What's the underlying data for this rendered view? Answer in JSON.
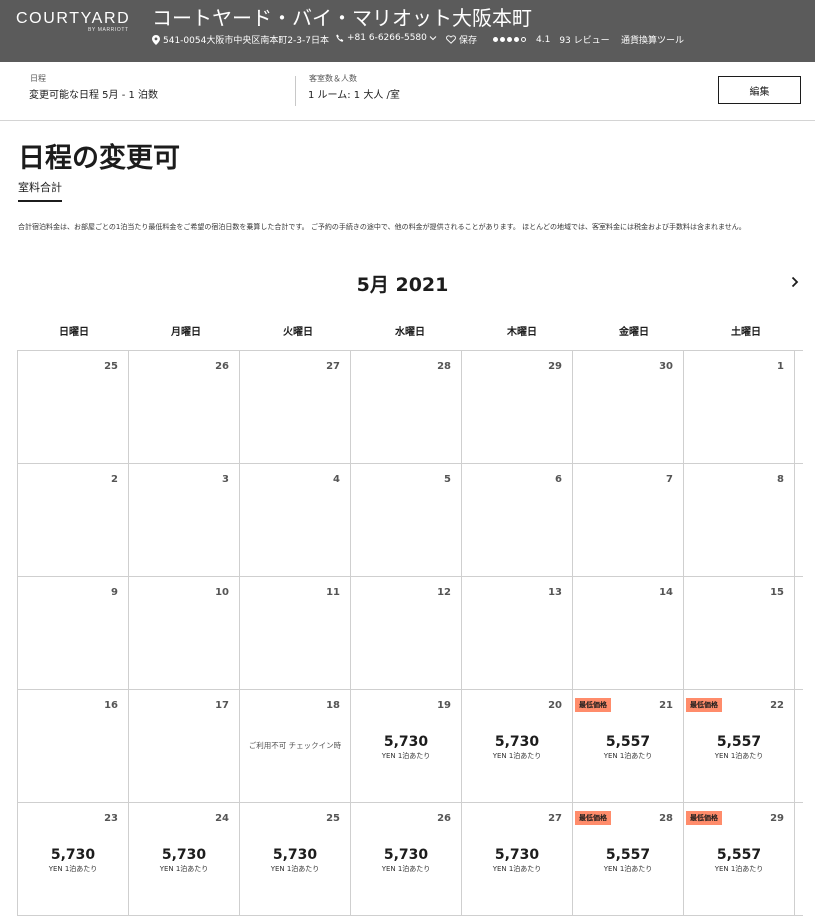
{
  "header": {
    "brand": "COURTYARD",
    "brand_sub": "BY MARRIOTT",
    "hotel_name": "コートヤード・バイ・マリオット大阪本町",
    "address": "541-0054大阪市中央区南本町2-3-7日本",
    "phone": "+81 6-6266-5580",
    "save": "保存",
    "rating": "4.1",
    "reviews": "93 レビュー",
    "currency_tool": "通貨換算ツール"
  },
  "search": {
    "dates_label": "日程",
    "dates_value": "変更可能な日程 5月 - 1 泊数",
    "guests_label": "客室数＆人数",
    "guests_value": "1 ルーム: 1 大人 /室",
    "edit": "編集"
  },
  "page": {
    "title": "日程の変更可",
    "tab": "室料合計",
    "disclaimer": "合計宿泊料金は、お部屋ごとの1泊当たり最低料金をご希望の宿泊日数を乗算した合計です。 ご予約の手続きの途中で、他の料金が提供されることがあります。 ほとんどの地域では、客室料金には税金および手数料は含まれません。"
  },
  "calendar": {
    "month": "5月 2021",
    "weekdays": [
      "日曜日",
      "月曜日",
      "火曜日",
      "水曜日",
      "木曜日",
      "金曜日",
      "土曜日"
    ],
    "badge": "最低価格",
    "unit": "YEN 1泊あたり",
    "unavailable": "ご利用不可 チェックイン時",
    "weeks": [
      [
        {
          "day": "25"
        },
        {
          "day": "26"
        },
        {
          "day": "27"
        },
        {
          "day": "28"
        },
        {
          "day": "29"
        },
        {
          "day": "30"
        },
        {
          "day": "1"
        }
      ],
      [
        {
          "day": "2"
        },
        {
          "day": "3"
        },
        {
          "day": "4"
        },
        {
          "day": "5"
        },
        {
          "day": "6"
        },
        {
          "day": "7"
        },
        {
          "day": "8"
        }
      ],
      [
        {
          "day": "9"
        },
        {
          "day": "10"
        },
        {
          "day": "11"
        },
        {
          "day": "12"
        },
        {
          "day": "13"
        },
        {
          "day": "14"
        },
        {
          "day": "15"
        }
      ],
      [
        {
          "day": "16"
        },
        {
          "day": "17"
        },
        {
          "day": "18",
          "unavailable": true
        },
        {
          "day": "19",
          "price": "5,730"
        },
        {
          "day": "20",
          "price": "5,730"
        },
        {
          "day": "21",
          "price": "5,557",
          "badge": true
        },
        {
          "day": "22",
          "price": "5,557",
          "badge": true
        }
      ],
      [
        {
          "day": "23",
          "price": "5,730"
        },
        {
          "day": "24",
          "price": "5,730"
        },
        {
          "day": "25",
          "price": "5,730"
        },
        {
          "day": "26",
          "price": "5,730"
        },
        {
          "day": "27",
          "price": "5,730"
        },
        {
          "day": "28",
          "price": "5,557",
          "badge": true
        },
        {
          "day": "29",
          "price": "5,557",
          "badge": true
        }
      ]
    ]
  },
  "colors": {
    "header_bg": "#5b5b5b",
    "badge_bg": "#ff8c6b"
  },
  "icons": {
    "location": "pin-icon",
    "phone": "phone-icon",
    "save": "heart-icon",
    "next": "chevron-right-icon"
  }
}
